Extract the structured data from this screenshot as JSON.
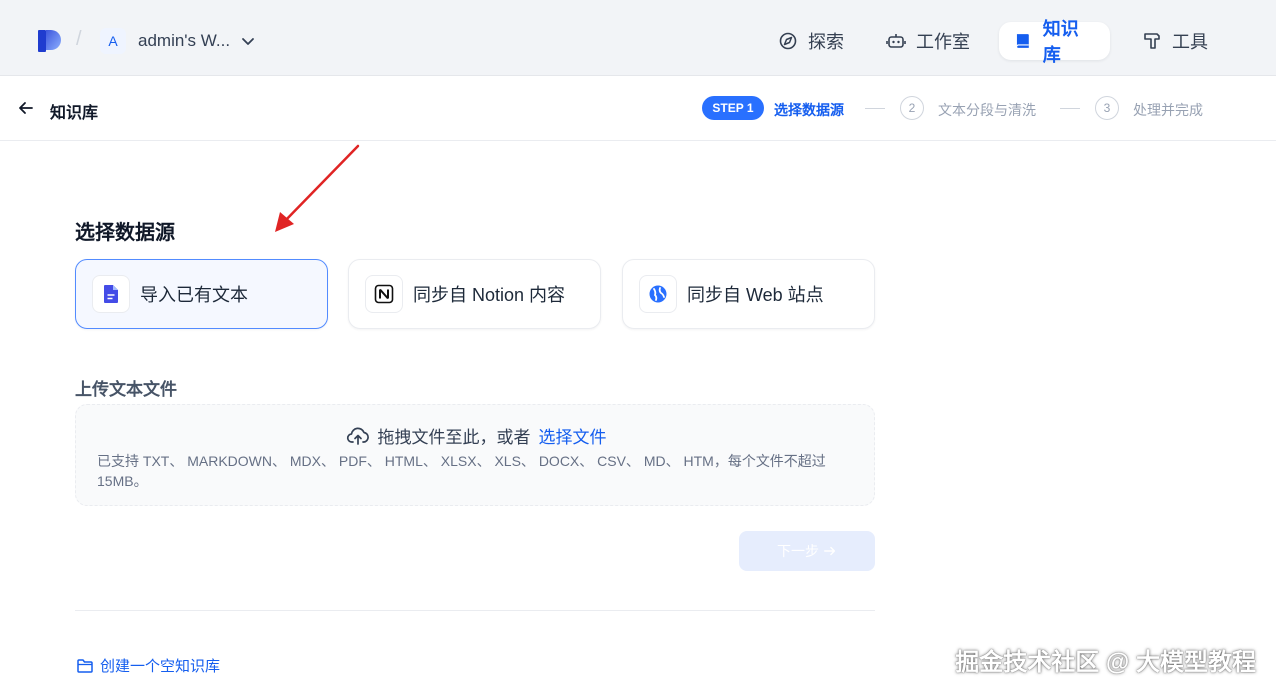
{
  "topbar": {
    "workspace_initial": "A",
    "workspace_name": "admin's W...",
    "nav": {
      "explore": "探索",
      "studio": "工作室",
      "knowledge": "知识库",
      "tools": "工具"
    }
  },
  "subheader": {
    "title": "知识库",
    "steps": [
      {
        "badge": "STEP 1",
        "label": "选择数据源",
        "state": "active"
      },
      {
        "number": "2",
        "label": "文本分段与清洗",
        "state": "pending"
      },
      {
        "number": "3",
        "label": "处理并完成",
        "state": "pending"
      }
    ]
  },
  "main": {
    "section_title": "选择数据源",
    "datasources": [
      {
        "label": "导入已有文本",
        "icon": "file-text-icon",
        "selected": true
      },
      {
        "label": "同步自 Notion 内容",
        "icon": "notion-icon",
        "selected": false
      },
      {
        "label": "同步自 Web 站点",
        "icon": "globe-icon",
        "selected": false
      }
    ],
    "upload": {
      "title": "上传文本文件",
      "prompt": "拖拽文件至此，或者",
      "link": "选择文件",
      "tip": "已支持 TXT、 MARKDOWN、 MDX、 PDF、 HTML、 XLSX、 XLS、 DOCX、 CSV、 MD、 HTM，每个文件不超过 15MB。"
    },
    "next_button": "下一步",
    "create_empty": "创建一个空知识库"
  },
  "watermark": "掘金技术社区 @ 大模型教程",
  "colors": {
    "accent": "#155eef",
    "step_badge": "#2970ff",
    "annotation_arrow": "#e02424",
    "topbar_bg": "#f2f4f7"
  }
}
